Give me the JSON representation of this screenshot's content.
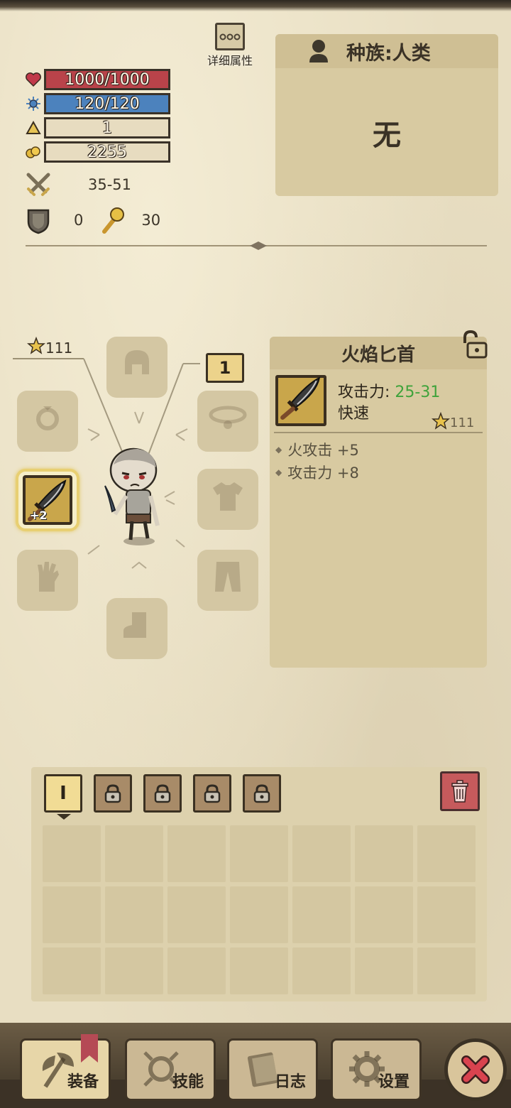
{
  "stats": {
    "hp": "1000/1000",
    "mp": "120/120",
    "level": "1",
    "gold": "2255",
    "attack": "35-51",
    "defense": "0",
    "magic_resist": "30"
  },
  "detail_button_label": "详细属性",
  "race": {
    "label": "种族:人类",
    "value": "无"
  },
  "character": {
    "level_label": "111",
    "slot_count": "1",
    "weapon_bonus": "+2"
  },
  "item": {
    "name": "火焰匕首",
    "attack_label": "攻击力:",
    "attack_value": "25-31",
    "speed": "快速",
    "level": "111",
    "affixes": [
      "火攻击 +5",
      "攻击力 +8"
    ]
  },
  "inventory": {
    "active_tab_label": "I"
  },
  "nav": {
    "equip": "装备",
    "skills": "技能",
    "log": "日志",
    "settings": "设置"
  },
  "colors": {
    "hp": "#b9434a",
    "mp": "#4c82bd",
    "attack_value": "#3fa33b",
    "gold_frame": "#c9a64b"
  }
}
